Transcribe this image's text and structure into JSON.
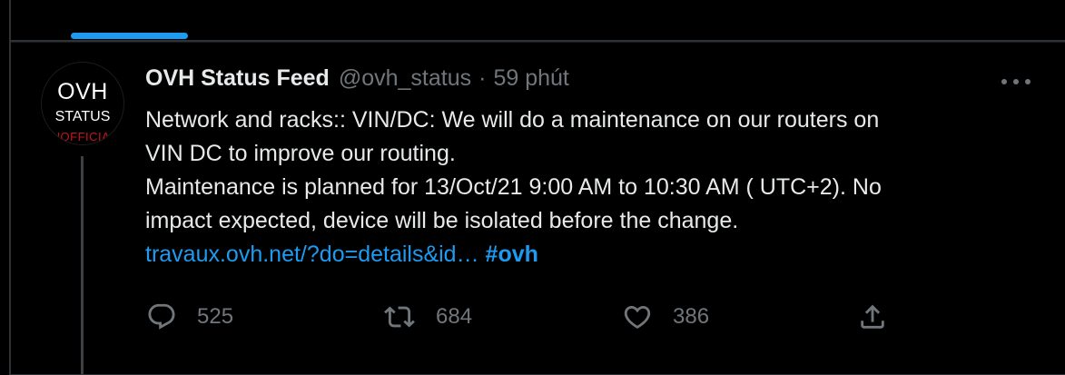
{
  "avatar": {
    "line1": "OVH",
    "line2": "STATUS",
    "line3": "NOFFICIA"
  },
  "tweet": {
    "display_name": "OVH Status Feed",
    "handle": "@ovh_status",
    "separator": "·",
    "time": "59 phút",
    "body_lines": [
      "Network and racks:: VIN/DC: We will do a maintenance on our routers on",
      "VIN DC to improve our routing.",
      "Maintenance is planned for 13/Oct/21 9:00 AM to 10:30 AM ( UTC+2). No",
      "impact expected, device will be isolated before the change."
    ],
    "link_text": "travaux.ovh.net/?do=details&id…",
    "hashtag": "#ovh"
  },
  "actions": {
    "replies": "525",
    "retweets": "684",
    "likes": "386"
  },
  "icons": {
    "reply": "reply-icon",
    "retweet": "retweet-icon",
    "like": "heart-icon",
    "share": "share-icon",
    "more": "more-icon"
  },
  "colors": {
    "accent": "#1d9bf0",
    "background": "#000000",
    "text": "#e7e9ea",
    "muted": "#71767b",
    "unofficial": "#c4161c"
  }
}
